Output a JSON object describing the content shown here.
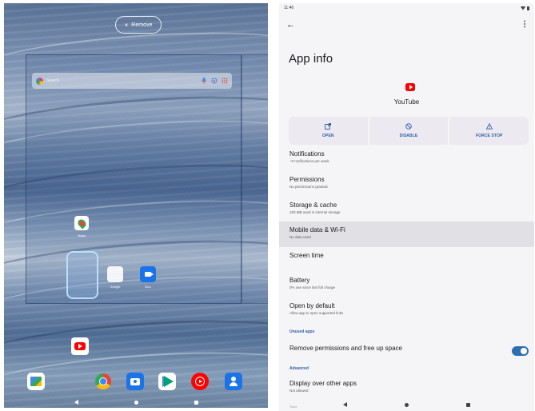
{
  "launcher": {
    "remove_label": "Remove",
    "search_placeholder": "Search",
    "apps": {
      "maps": "Maps",
      "google": "Google",
      "duo": "Duo"
    },
    "dock_icons": [
      "gallery-go-icon",
      "chrome-icon",
      "camera-icon",
      "play-store-icon",
      "youtube-music-icon",
      "contacts-icon"
    ],
    "colors": {
      "drop_target_border": "#bee1ff",
      "panel_border": "#1e325a"
    }
  },
  "settings": {
    "status_time": "11:46",
    "title": "App info",
    "app_name": "YouTube",
    "actions": [
      {
        "label": "OPEN",
        "icon": "open-in-new-icon"
      },
      {
        "label": "DISABLE",
        "icon": "block-icon"
      },
      {
        "label": "FORCE STOP",
        "icon": "warning-icon"
      }
    ],
    "rows": [
      {
        "title": "Notifications",
        "sub": "~0 notifications per week"
      },
      {
        "title": "Permissions",
        "sub": "No permissions granted"
      },
      {
        "title": "Storage & cache",
        "sub": "100 MB used in internal storage"
      },
      {
        "title": "Mobile data & Wi-Fi",
        "sub": "No data used"
      },
      {
        "title": "Screen time",
        "sub": ""
      },
      {
        "title": "Battery",
        "sub": "0% use since last full charge"
      },
      {
        "title": "Open by default",
        "sub": "Allow app to open supported links"
      }
    ],
    "section_unused": "Unused apps",
    "unused_toggle_label": "Remove permissions and free up space",
    "unused_toggle_on": true,
    "section_advanced": "Advanced",
    "display_over": {
      "title": "Display over other apps",
      "sub": "Not allowed"
    },
    "store_peek": "Store",
    "colors": {
      "accent": "#2d5ea8",
      "toggle_on": "#2d6fb0",
      "youtube_red": "#ff0000"
    }
  }
}
